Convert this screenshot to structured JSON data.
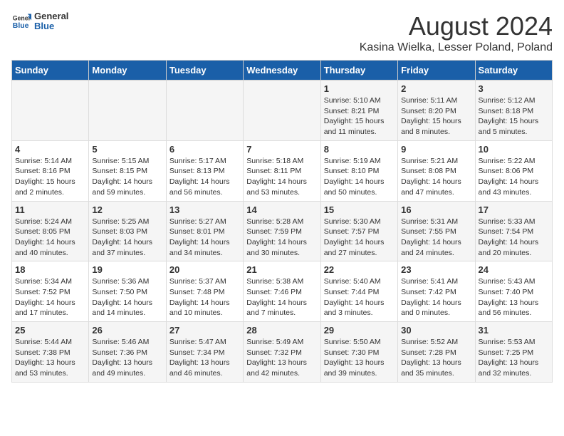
{
  "header": {
    "logo_general": "General",
    "logo_blue": "Blue",
    "main_title": "August 2024",
    "subtitle": "Kasina Wielka, Lesser Poland, Poland"
  },
  "weekdays": [
    "Sunday",
    "Monday",
    "Tuesday",
    "Wednesday",
    "Thursday",
    "Friday",
    "Saturday"
  ],
  "weeks": [
    [
      {
        "day": "",
        "sunrise": "",
        "sunset": "",
        "daylight": ""
      },
      {
        "day": "",
        "sunrise": "",
        "sunset": "",
        "daylight": ""
      },
      {
        "day": "",
        "sunrise": "",
        "sunset": "",
        "daylight": ""
      },
      {
        "day": "",
        "sunrise": "",
        "sunset": "",
        "daylight": ""
      },
      {
        "day": "1",
        "sunrise": "Sunrise: 5:10 AM",
        "sunset": "Sunset: 8:21 PM",
        "daylight": "Daylight: 15 hours and 11 minutes."
      },
      {
        "day": "2",
        "sunrise": "Sunrise: 5:11 AM",
        "sunset": "Sunset: 8:20 PM",
        "daylight": "Daylight: 15 hours and 8 minutes."
      },
      {
        "day": "3",
        "sunrise": "Sunrise: 5:12 AM",
        "sunset": "Sunset: 8:18 PM",
        "daylight": "Daylight: 15 hours and 5 minutes."
      }
    ],
    [
      {
        "day": "4",
        "sunrise": "Sunrise: 5:14 AM",
        "sunset": "Sunset: 8:16 PM",
        "daylight": "Daylight: 15 hours and 2 minutes."
      },
      {
        "day": "5",
        "sunrise": "Sunrise: 5:15 AM",
        "sunset": "Sunset: 8:15 PM",
        "daylight": "Daylight: 14 hours and 59 minutes."
      },
      {
        "day": "6",
        "sunrise": "Sunrise: 5:17 AM",
        "sunset": "Sunset: 8:13 PM",
        "daylight": "Daylight: 14 hours and 56 minutes."
      },
      {
        "day": "7",
        "sunrise": "Sunrise: 5:18 AM",
        "sunset": "Sunset: 8:11 PM",
        "daylight": "Daylight: 14 hours and 53 minutes."
      },
      {
        "day": "8",
        "sunrise": "Sunrise: 5:19 AM",
        "sunset": "Sunset: 8:10 PM",
        "daylight": "Daylight: 14 hours and 50 minutes."
      },
      {
        "day": "9",
        "sunrise": "Sunrise: 5:21 AM",
        "sunset": "Sunset: 8:08 PM",
        "daylight": "Daylight: 14 hours and 47 minutes."
      },
      {
        "day": "10",
        "sunrise": "Sunrise: 5:22 AM",
        "sunset": "Sunset: 8:06 PM",
        "daylight": "Daylight: 14 hours and 43 minutes."
      }
    ],
    [
      {
        "day": "11",
        "sunrise": "Sunrise: 5:24 AM",
        "sunset": "Sunset: 8:05 PM",
        "daylight": "Daylight: 14 hours and 40 minutes."
      },
      {
        "day": "12",
        "sunrise": "Sunrise: 5:25 AM",
        "sunset": "Sunset: 8:03 PM",
        "daylight": "Daylight: 14 hours and 37 minutes."
      },
      {
        "day": "13",
        "sunrise": "Sunrise: 5:27 AM",
        "sunset": "Sunset: 8:01 PM",
        "daylight": "Daylight: 14 hours and 34 minutes."
      },
      {
        "day": "14",
        "sunrise": "Sunrise: 5:28 AM",
        "sunset": "Sunset: 7:59 PM",
        "daylight": "Daylight: 14 hours and 30 minutes."
      },
      {
        "day": "15",
        "sunrise": "Sunrise: 5:30 AM",
        "sunset": "Sunset: 7:57 PM",
        "daylight": "Daylight: 14 hours and 27 minutes."
      },
      {
        "day": "16",
        "sunrise": "Sunrise: 5:31 AM",
        "sunset": "Sunset: 7:55 PM",
        "daylight": "Daylight: 14 hours and 24 minutes."
      },
      {
        "day": "17",
        "sunrise": "Sunrise: 5:33 AM",
        "sunset": "Sunset: 7:54 PM",
        "daylight": "Daylight: 14 hours and 20 minutes."
      }
    ],
    [
      {
        "day": "18",
        "sunrise": "Sunrise: 5:34 AM",
        "sunset": "Sunset: 7:52 PM",
        "daylight": "Daylight: 14 hours and 17 minutes."
      },
      {
        "day": "19",
        "sunrise": "Sunrise: 5:36 AM",
        "sunset": "Sunset: 7:50 PM",
        "daylight": "Daylight: 14 hours and 14 minutes."
      },
      {
        "day": "20",
        "sunrise": "Sunrise: 5:37 AM",
        "sunset": "Sunset: 7:48 PM",
        "daylight": "Daylight: 14 hours and 10 minutes."
      },
      {
        "day": "21",
        "sunrise": "Sunrise: 5:38 AM",
        "sunset": "Sunset: 7:46 PM",
        "daylight": "Daylight: 14 hours and 7 minutes."
      },
      {
        "day": "22",
        "sunrise": "Sunrise: 5:40 AM",
        "sunset": "Sunset: 7:44 PM",
        "daylight": "Daylight: 14 hours and 3 minutes."
      },
      {
        "day": "23",
        "sunrise": "Sunrise: 5:41 AM",
        "sunset": "Sunset: 7:42 PM",
        "daylight": "Daylight: 14 hours and 0 minutes."
      },
      {
        "day": "24",
        "sunrise": "Sunrise: 5:43 AM",
        "sunset": "Sunset: 7:40 PM",
        "daylight": "Daylight: 13 hours and 56 minutes."
      }
    ],
    [
      {
        "day": "25",
        "sunrise": "Sunrise: 5:44 AM",
        "sunset": "Sunset: 7:38 PM",
        "daylight": "Daylight: 13 hours and 53 minutes."
      },
      {
        "day": "26",
        "sunrise": "Sunrise: 5:46 AM",
        "sunset": "Sunset: 7:36 PM",
        "daylight": "Daylight: 13 hours and 49 minutes."
      },
      {
        "day": "27",
        "sunrise": "Sunrise: 5:47 AM",
        "sunset": "Sunset: 7:34 PM",
        "daylight": "Daylight: 13 hours and 46 minutes."
      },
      {
        "day": "28",
        "sunrise": "Sunrise: 5:49 AM",
        "sunset": "Sunset: 7:32 PM",
        "daylight": "Daylight: 13 hours and 42 minutes."
      },
      {
        "day": "29",
        "sunrise": "Sunrise: 5:50 AM",
        "sunset": "Sunset: 7:30 PM",
        "daylight": "Daylight: 13 hours and 39 minutes."
      },
      {
        "day": "30",
        "sunrise": "Sunrise: 5:52 AM",
        "sunset": "Sunset: 7:28 PM",
        "daylight": "Daylight: 13 hours and 35 minutes."
      },
      {
        "day": "31",
        "sunrise": "Sunrise: 5:53 AM",
        "sunset": "Sunset: 7:25 PM",
        "daylight": "Daylight: 13 hours and 32 minutes."
      }
    ]
  ]
}
